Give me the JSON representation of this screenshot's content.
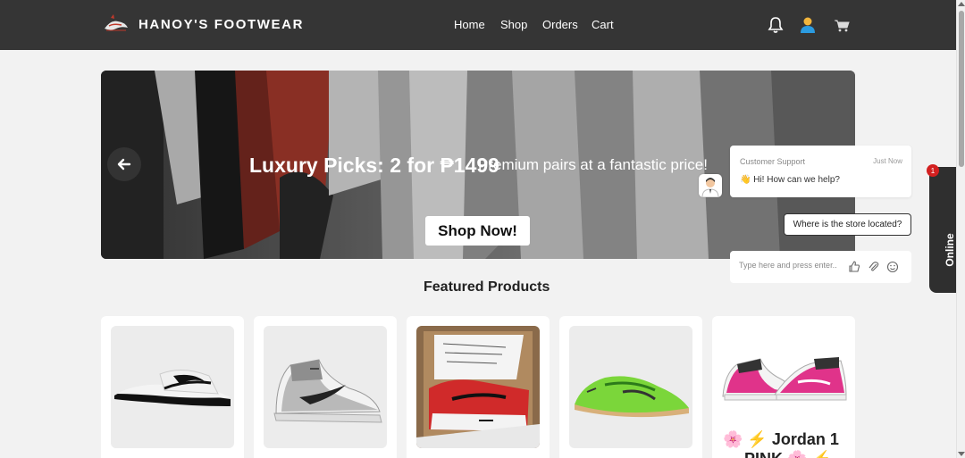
{
  "header": {
    "brand": "HANOY'S FOOTWEAR",
    "nav": [
      "Home",
      "Shop",
      "Orders",
      "Cart"
    ],
    "icons": [
      "bell-icon",
      "user-icon",
      "cart-icon"
    ],
    "background": "#353535"
  },
  "hero": {
    "title": "Luxury Picks: 2 for ₱1499",
    "subtitle": "Premium pairs at a fantastic price!",
    "cta": "Shop Now!"
  },
  "featured": {
    "title": "Featured Products",
    "products": [
      {
        "name": ""
      },
      {
        "name": ""
      },
      {
        "name": ""
      },
      {
        "name": ""
      },
      {
        "name_line1": "🌸 ⚡ Jordan 1",
        "name_line2": "PINK 🌸 ⚡"
      }
    ]
  },
  "chat": {
    "tab_label": "Online",
    "badge": "1",
    "agent": "Customer Support",
    "time": "Just Now",
    "message": "👋 Hi! How can we help?",
    "quick_reply": "Where is the store located?",
    "input_placeholder": "Type here and press enter.."
  },
  "colors": {
    "accent": "#2b9be0",
    "badge": "#d32020"
  }
}
